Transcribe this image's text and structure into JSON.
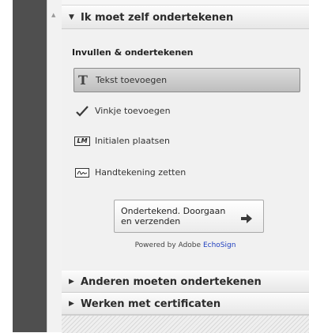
{
  "sections": [
    {
      "title": "Ik moet zelf ondertekenen",
      "expanded": true
    },
    {
      "title": "Anderen moeten ondertekenen",
      "expanded": false
    },
    {
      "title": "Werken met certificaten",
      "expanded": false
    }
  ],
  "fill_sign": {
    "heading": "Invullen & ondertekenen",
    "tools": [
      {
        "label": "Tekst toevoegen",
        "icon": "text-T-icon",
        "selected": true
      },
      {
        "label": "Vinkje toevoegen",
        "icon": "checkmark-icon",
        "selected": false
      },
      {
        "label": "Initialen plaatsen",
        "icon": "initials-LM-icon",
        "selected": false
      },
      {
        "label": "Handtekening zetten",
        "icon": "signature-icon",
        "selected": false
      }
    ],
    "send_button": {
      "label": "Ondertekend. Doorgaan en verzenden"
    },
    "powered_prefix": "Powered by Adobe",
    "powered_brand": "EchoSign"
  },
  "colors": {
    "brand": "#1f3fbf",
    "selected_tool": "#c8c8c8"
  }
}
